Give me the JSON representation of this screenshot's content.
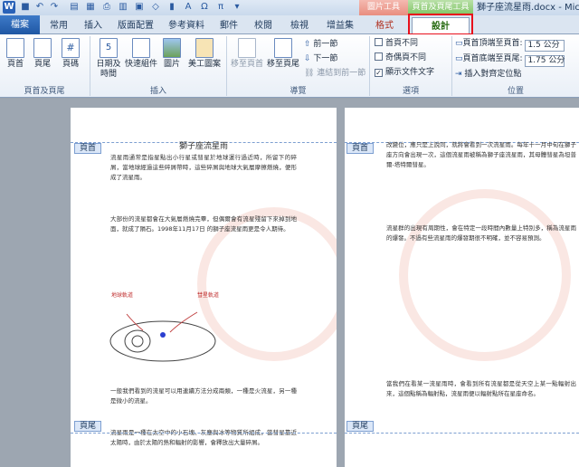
{
  "window": {
    "title": "獅子座流星雨.docx - Microsoft Word"
  },
  "context_tabs": {
    "group1": "圖片工具",
    "group2": "頁首及頁尾工具"
  },
  "tabs": [
    "常用",
    "插入",
    "版面配置",
    "參考資料",
    "郵件",
    "校閱",
    "檢視",
    "增益集",
    "格式",
    "設計"
  ],
  "file_tab": "檔案",
  "ribbon": {
    "groups": [
      "頁首及頁尾",
      "插入",
      "導覽",
      "選項",
      "位置"
    ],
    "header": "頁首",
    "footer": "頁尾",
    "page_number": "頁碼",
    "date_time": "日期及\n時間",
    "quick_parts": "快速組件",
    "picture": "圖片",
    "clip_art": "美工圖案",
    "goto_header": "移至頁首",
    "goto_footer": "移至頁尾",
    "previous": "前一節",
    "next": "下一節",
    "link_previous": "連結到前一節",
    "diff_first": "首頁不同",
    "diff_odd_even": "奇偶頁不同",
    "show_doc_text": "顯示文件文字",
    "header_from_top": "頁首頂端至頁首:",
    "header_from_top_value": "1.5 公分",
    "footer_from_bottom": "頁首底端至頁尾:",
    "footer_from_bottom_value": "1.75 公分",
    "insert_align_tab": "插入對齊定位點"
  },
  "document": {
    "header_tag": "頁首",
    "footer_tag": "頁尾",
    "title": "獅子座流星雨",
    "p1": "流星雨通常是指星點出小行星或彗星於地球運行過近時，所留下的碎屑，當地球經過這些碎屑帶時，這些碎屑與地球大氣層摩擦燃燒，便形成了流星雨。",
    "p2": "大部份的流星都會在大氣層燃燒完畢，但偶爾會有流星殘留下來掉到地面，就成了隕石。1998年11月17日 的獅子座流星雨更是令人期待。",
    "fig_label1": "地球軌道",
    "fig_label2": "彗星軌道",
    "p3": "一般我們看到的流星可以用連續方法分成兩類，一種是火流星，另一種是微小的流星。",
    "p4": "流星雨是一種在太空中的小石塊、灰塵與冰等物質所組成，當彗星靠近太陽時，由於太陽的熱和輻射的影響，會釋放出大量碎屑。",
    "p5": "改變位，應只是上說同，就將會看到一次流星雨。每年十一月中旬在獅子座方向會出現一次，這個流星雨被稱為獅子座流星雨，其母體彗星為坦普爾-塔特爾彗星。",
    "p6": "流星群的出現有周期性，會在特定一段時間內數量上特別多，稱為流星雨的爆發。不過有些流星雨的爆發期很不明確，並不容易預測。",
    "p7": "當我們在看某一流星雨時，會看到所有流星都是從天空上某一點輻射出來，這個點稱為輻射點，流星雨便以輻射點所在星座命名。"
  }
}
